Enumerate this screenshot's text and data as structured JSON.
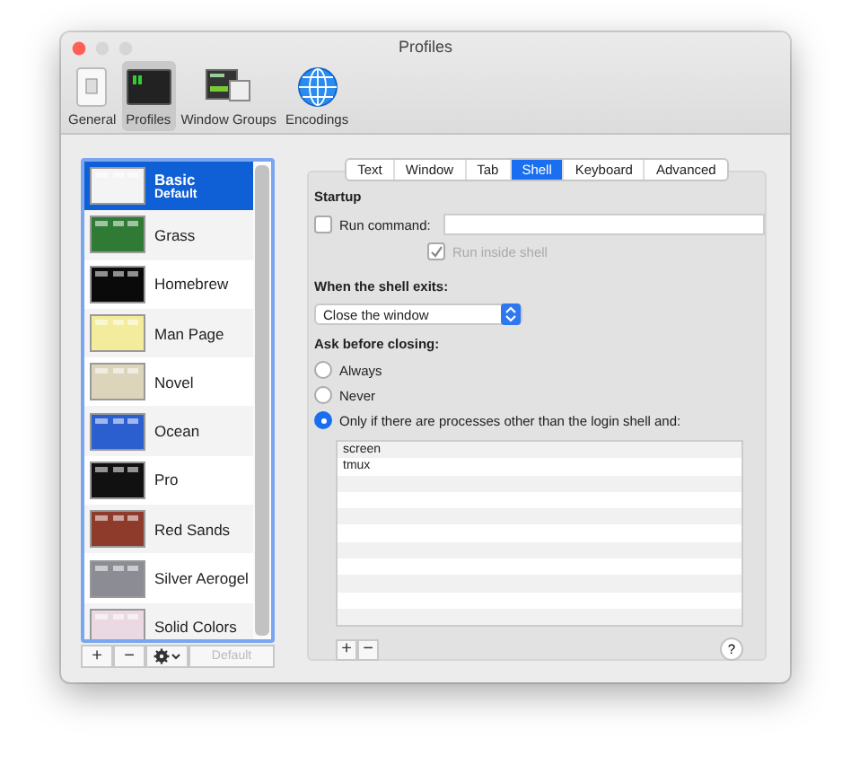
{
  "window": {
    "title": "Profiles"
  },
  "toolbar": [
    {
      "label": "General",
      "kind": "general",
      "selected": false
    },
    {
      "label": "Profiles",
      "kind": "profiles",
      "selected": true
    },
    {
      "label": "Window Groups",
      "kind": "groups",
      "selected": false
    },
    {
      "label": "Encodings",
      "kind": "encodings",
      "selected": false
    }
  ],
  "profiles": [
    {
      "name": "Basic",
      "subtitle": "Default",
      "color": "#f4f4f4",
      "selected": true
    },
    {
      "name": "Grass",
      "color": "#2f7a35",
      "selected": false
    },
    {
      "name": "Homebrew",
      "color": "#0a0a0a",
      "selected": false
    },
    {
      "name": "Man Page",
      "color": "#f2ec9c",
      "selected": false
    },
    {
      "name": "Novel",
      "color": "#dcd5bb",
      "selected": false
    },
    {
      "name": "Ocean",
      "color": "#2b5fd0",
      "selected": false
    },
    {
      "name": "Pro",
      "color": "#111111",
      "selected": false
    },
    {
      "name": "Red Sands",
      "color": "#8e3b2c",
      "selected": false
    },
    {
      "name": "Silver Aerogel",
      "color": "#8c8c94",
      "selected": false
    },
    {
      "name": "Solid Colors",
      "color": "#ead9e2",
      "selected": false
    }
  ],
  "list_actions": {
    "add": "+",
    "remove": "−",
    "default_button": {
      "label": "Default",
      "disabled": true
    }
  },
  "tabs": [
    {
      "label": "Text",
      "selected": false
    },
    {
      "label": "Window",
      "selected": false
    },
    {
      "label": "Tab",
      "selected": false
    },
    {
      "label": "Shell",
      "selected": true
    },
    {
      "label": "Keyboard",
      "selected": false
    },
    {
      "label": "Advanced",
      "selected": false
    }
  ],
  "startup": {
    "heading": "Startup",
    "run_command": {
      "label": "Run command:",
      "checked": false
    },
    "run_inside_shell": {
      "label": "Run inside shell",
      "checked": true,
      "disabled": true
    }
  },
  "shell_exits": {
    "heading": "When the shell exits:",
    "value": "Close the window"
  },
  "ask_before_closing": {
    "heading": "Ask before closing:",
    "options": [
      {
        "label": "Always",
        "selected": false
      },
      {
        "label": "Never",
        "selected": false
      },
      {
        "label": "Only if there are processes other than the login shell and:",
        "selected": true
      }
    ]
  },
  "processes": [
    "screen",
    "tmux"
  ],
  "process_actions": {
    "add": "+",
    "remove": "−"
  },
  "help": "?"
}
